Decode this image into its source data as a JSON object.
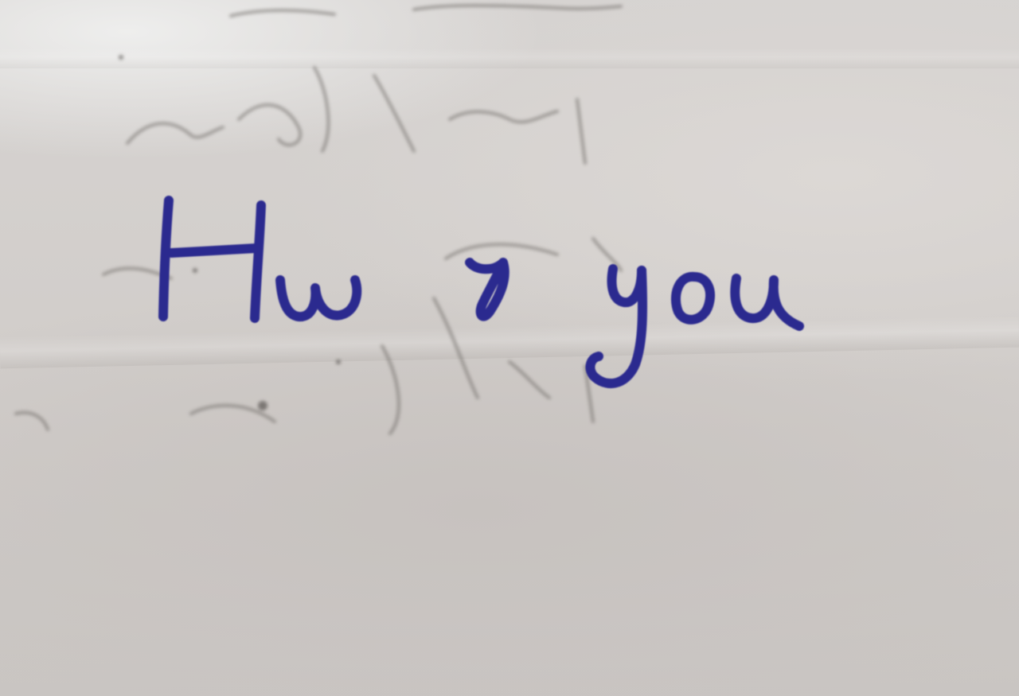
{
  "handwriting": {
    "text": "Hw r you",
    "ink_color": "#2b2a8f"
  },
  "paper": {
    "color": "#d2cecb"
  }
}
